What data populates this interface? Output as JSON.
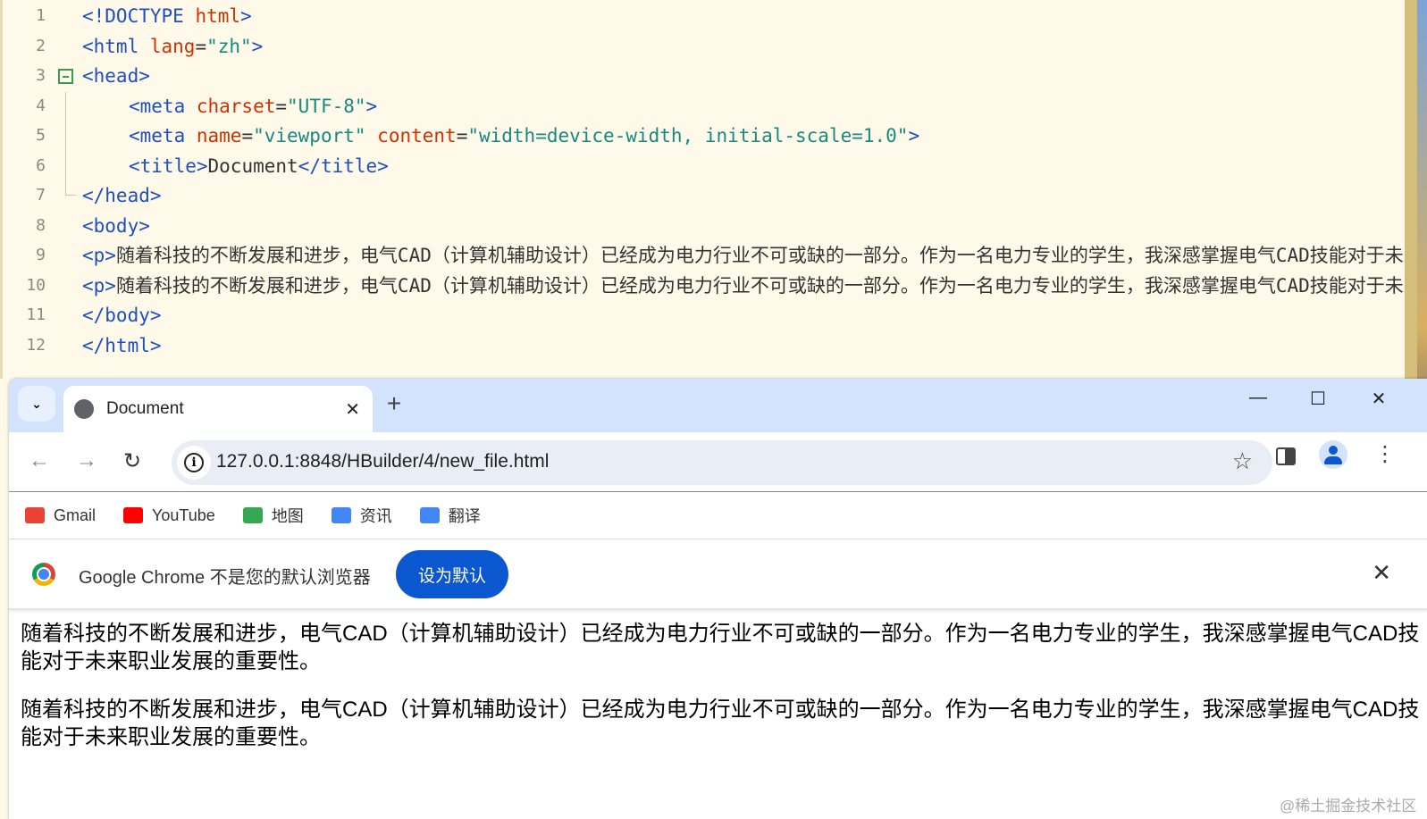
{
  "editor": {
    "lines": [
      {
        "n": "1",
        "indent": 0,
        "tokens": [
          [
            "tag",
            "<!DOCTYPE "
          ],
          [
            "attr",
            "html"
          ],
          [
            "tag",
            ">"
          ]
        ]
      },
      {
        "n": "2",
        "indent": 0,
        "tokens": [
          [
            "tag",
            "<html "
          ],
          [
            "attr",
            "lang"
          ],
          [
            "txt",
            "="
          ],
          [
            "str",
            "\"zh\""
          ],
          [
            "tag",
            ">"
          ]
        ]
      },
      {
        "n": "3",
        "indent": 0,
        "tokens": [
          [
            "tag",
            "<head>"
          ]
        ]
      },
      {
        "n": "4",
        "indent": 1,
        "tokens": [
          [
            "tag",
            "<meta "
          ],
          [
            "attr",
            "charset"
          ],
          [
            "txt",
            "="
          ],
          [
            "str",
            "\"UTF-8\""
          ],
          [
            "tag",
            ">"
          ]
        ]
      },
      {
        "n": "5",
        "indent": 1,
        "tokens": [
          [
            "tag",
            "<meta "
          ],
          [
            "attr",
            "name"
          ],
          [
            "txt",
            "="
          ],
          [
            "str",
            "\"viewport\" "
          ],
          [
            "attr",
            "content"
          ],
          [
            "txt",
            "="
          ],
          [
            "str",
            "\"width=device-width, initial-scale=1.0\""
          ],
          [
            "tag",
            ">"
          ]
        ]
      },
      {
        "n": "6",
        "indent": 1,
        "tokens": [
          [
            "tag",
            "<title>"
          ],
          [
            "txt",
            "Document"
          ],
          [
            "tag",
            "</title>"
          ]
        ]
      },
      {
        "n": "7",
        "indent": 0,
        "tokens": [
          [
            "tag",
            "</head>"
          ]
        ]
      },
      {
        "n": "8",
        "indent": 0,
        "tokens": [
          [
            "tag",
            "<body>"
          ]
        ]
      },
      {
        "n": "9",
        "indent": 0,
        "tokens": [
          [
            "tag",
            "<p>"
          ],
          [
            "txt",
            "随着科技的不断发展和进步，电气CAD（计算机辅助设计）已经成为电力行业不可或缺的一部分。作为一名电力专业的学生，我深感掌握电气CAD技能对于未来职业发展的重要性。"
          ],
          [
            "tag",
            "</p>"
          ]
        ]
      },
      {
        "n": "10",
        "indent": 0,
        "tokens": [
          [
            "tag",
            "<p>"
          ],
          [
            "txt",
            "随着科技的不断发展和进步，电气CAD（计算机辅助设计）已经成为电力行业不可或缺的一部分。作为一名电力专业的学生，我深感掌握电气CAD技能对于未来职业发展的重要性。"
          ],
          [
            "tag",
            "</p>"
          ]
        ]
      },
      {
        "n": "11",
        "indent": 0,
        "tokens": [
          [
            "tag",
            "</body>"
          ]
        ]
      },
      {
        "n": "12",
        "indent": 0,
        "tokens": [
          [
            "tag",
            "</html>"
          ]
        ]
      }
    ]
  },
  "browser": {
    "tab": {
      "title": "Document",
      "close": "✕",
      "icon": "globe-icon"
    },
    "new_tab": "+",
    "window_controls": {
      "minimize": "—",
      "maximize": "☐",
      "close": "✕"
    },
    "nav": {
      "back": "←",
      "forward": "→",
      "reload": "↻"
    },
    "url": "127.0.0.1:8848/HBuilder/4/new_file.html",
    "info_glyph": "i",
    "star": "☆",
    "menu": "⋮",
    "bookmarks": [
      {
        "label": "Gmail",
        "color": "#ea4335"
      },
      {
        "label": "YouTube",
        "color": "#ff0000"
      },
      {
        "label": "地图",
        "color": "#34a853"
      },
      {
        "label": "资讯",
        "color": "#4285f4"
      },
      {
        "label": "翻译",
        "color": "#4285f4"
      }
    ],
    "infobar": {
      "text": "Google Chrome 不是您的默认浏览器",
      "button": "设为默认",
      "close": "✕"
    },
    "accent": "#0b57d0"
  },
  "page": {
    "paragraphs": [
      "随着科技的不断发展和进步，电气CAD（计算机辅助设计）已经成为电力行业不可或缺的一部分。作为一名电力专业的学生，我深感掌握电气CAD技能对于未来职业发展的重要性。",
      "随着科技的不断发展和进步，电气CAD（计算机辅助设计）已经成为电力行业不可或缺的一部分。作为一名电力专业的学生，我深感掌握电气CAD技能对于未来职业发展的重要性。"
    ]
  },
  "watermark": "@稀土掘金技术社区"
}
